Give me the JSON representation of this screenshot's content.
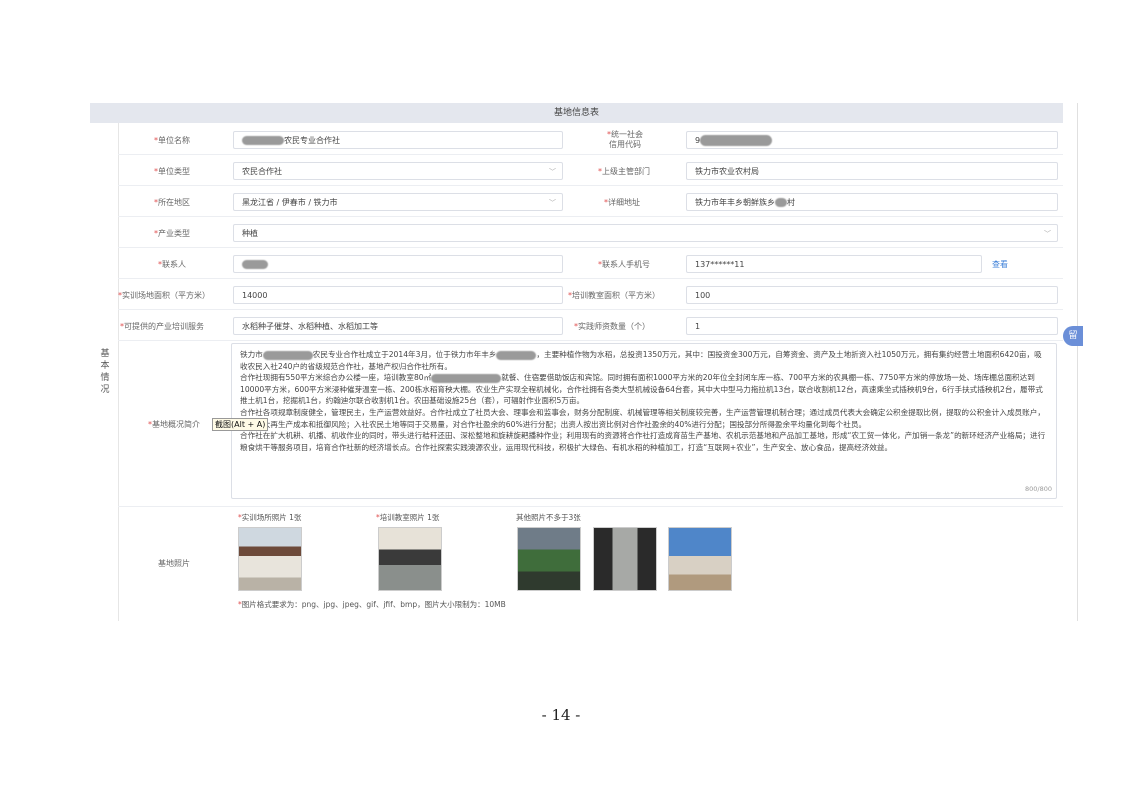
{
  "table_title": "基地信息表",
  "side_label": "基本情况",
  "fields": {
    "unit_name_label": "单位名称",
    "unit_name_value": "农民专业合作社",
    "credit_code_label_1": "统一社会",
    "credit_code_label_2": "信用代码",
    "credit_code_value": "9",
    "unit_type_label": "单位类型",
    "unit_type_value": "农民合作社",
    "superior_label": "上级主管部门",
    "superior_value": "铁力市农业农村局",
    "region_label": "所在地区",
    "region_value": "黑龙江省 / 伊春市 / 铁力市",
    "address_label": "详细地址",
    "address_value_a": "铁力市年丰乡朝鲜族乡",
    "address_value_b": "村",
    "industry_label": "产业类型",
    "industry_value": "种植",
    "contact_label": "联系人",
    "phone_label": "联系人手机号",
    "phone_value": "137******11",
    "view_link": "查看",
    "site_area_label": "实训场地面积（平方米）",
    "site_area_value": "14000",
    "classroom_area_label": "培训教室面积（平方米）",
    "classroom_area_value": "100",
    "service_label": "可提供的产业培训服务",
    "service_value": "水稻种子催芽、水稻种植、水稻加工等",
    "teacher_label": "实践师资数量（个）",
    "teacher_value": "1",
    "intro_label": "基地概况简介",
    "photos_label": "基地照片"
  },
  "intro": {
    "p1a": "铁力市",
    "p1b": "农民专业合作社成立于2014年3月，位于铁力市年丰乡",
    "p1c": "，主要种植作物为水稻，总投资1350万元，其中：国投资金300万元，自筹资金、资产及土地折资入社1050万元，拥有集约经营土地面积6420亩，吸收农民入社240户的省级规范合作社，基地产权归合作社所有。",
    "p2a": "合作社现拥有550平方米综合办公楼一座，培训教室80㎡",
    "p2b": "就餐、住宿要借助饭店和宾馆。同时拥有面积1000平方米的20年位全封闭车库一栋、700平方米的农具棚一栋、7750平方米的停放场一处、场库棚总面积达到10000平方米，600平方米浸种催芽温室一栋、200栋水稻育秧大棚。农业生产实现全程机械化，合作社拥有各类大型机械设备64台套，其中大中型马力拖拉机13台，联合收割机12台，高速乘坐式插秧机9台，6行手扶式插秧机2台，履带式推土机1台，挖掘机1台，约翰迪尔联合收割机1台。农田基础设施25台（套），可辐射作业面积5万亩。",
    "p3": "合作社各项规章制度健全，管理民主，生产运营效益好。合作社成立了社员大会、理事会和监事会，财务分配制度、机械管理等相关制度较完善，生产运营管理机制合理；通过成员代表大会确定公积金提取比例，提取的公积金计入成员账户，用于扩大再生产成本和抵御风险；入社农民土地等同于交易量，对合作社盈余的60%进行分配；出资人按出资比例对合作社盈余的40%进行分配；国投部分所得盈余平均量化到每个社员。",
    "p4": "合作社在扩大机耕、机播、机收作业的同时，带头进行秸秆还田、深松整地和旋耕旋耙播种作业；利用现有的资源将合作社打造成育苗生产基地、农机示范基地和产品加工基地，形成“农工贸一体化，产加销一条龙”的新环经济产业格局；进行粮食烘干等服务项目，培育合作社新的经济增长点。合作社探索实践澳源农业，运用现代科技，积极扩大绿色、有机水稻的种植加工，打造“互联网+农业”，生产安全、放心食品，提高经济效益。",
    "counter": "800/800"
  },
  "tooltip": "截图(Alt + A)",
  "photos": {
    "site_caption": "实训场所照片 1张",
    "classroom_caption": "培训教室照片 1张",
    "other_caption": "其他照片不多于3张",
    "format_note": "图片格式要求为：png、jpg、jpeg、gif、jfif、bmp，图片大小限制为：10MB"
  },
  "scroll_tab": "留",
  "page_number": "- 14 -",
  "colors": {
    "required": "#e05050",
    "link": "#3b7fd8",
    "header": "#e4e7ee"
  }
}
